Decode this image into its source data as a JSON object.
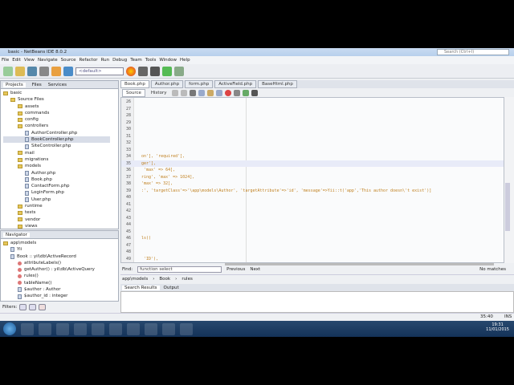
{
  "window": {
    "title": "basic - NetBeans IDE 8.0.2"
  },
  "menu": [
    "File",
    "Edit",
    "View",
    "Navigate",
    "Source",
    "Refactor",
    "Run",
    "Debug",
    "Team",
    "Tools",
    "Window",
    "Help"
  ],
  "search": {
    "placeholder": "Search (Ctrl+I)"
  },
  "toolbar": {
    "config": "<default>"
  },
  "projects": {
    "tabs": [
      "Projects",
      "Files",
      "Services"
    ],
    "tree": [
      {
        "label": "basic",
        "depth": 0,
        "type": "project"
      },
      {
        "label": "Source Files",
        "depth": 1,
        "type": "folder"
      },
      {
        "label": "assets",
        "depth": 2,
        "type": "folder"
      },
      {
        "label": "commands",
        "depth": 2,
        "type": "folder"
      },
      {
        "label": "config",
        "depth": 2,
        "type": "folder"
      },
      {
        "label": "controllers",
        "depth": 2,
        "type": "folder"
      },
      {
        "label": "AuthorController.php",
        "depth": 3,
        "type": "file"
      },
      {
        "label": "BookController.php",
        "depth": 3,
        "type": "file",
        "selected": true
      },
      {
        "label": "SiteController.php",
        "depth": 3,
        "type": "file"
      },
      {
        "label": "mail",
        "depth": 2,
        "type": "folder"
      },
      {
        "label": "migrations",
        "depth": 2,
        "type": "folder"
      },
      {
        "label": "models",
        "depth": 2,
        "type": "folder"
      },
      {
        "label": "Author.php",
        "depth": 3,
        "type": "file"
      },
      {
        "label": "Book.php",
        "depth": 3,
        "type": "file"
      },
      {
        "label": "ContactForm.php",
        "depth": 3,
        "type": "file"
      },
      {
        "label": "LoginForm.php",
        "depth": 3,
        "type": "file"
      },
      {
        "label": "User.php",
        "depth": 3,
        "type": "file"
      },
      {
        "label": "runtime",
        "depth": 2,
        "type": "folder"
      },
      {
        "label": "tests",
        "depth": 2,
        "type": "folder"
      },
      {
        "label": "vendor",
        "depth": 2,
        "type": "folder"
      },
      {
        "label": "views",
        "depth": 2,
        "type": "folder"
      }
    ]
  },
  "navigator": {
    "title": "Navigator",
    "items": [
      {
        "label": "app\\models",
        "depth": 0,
        "type": "folder"
      },
      {
        "label": "Yii",
        "depth": 1,
        "type": "file"
      },
      {
        "label": "Book :: yii\\db\\ActiveRecord",
        "depth": 1,
        "type": "file"
      },
      {
        "label": "attributeLabels()",
        "depth": 2,
        "type": "method"
      },
      {
        "label": "getAuthor() : yii\\db\\ActiveQuery",
        "depth": 2,
        "type": "method"
      },
      {
        "label": "rules()",
        "depth": 2,
        "type": "method"
      },
      {
        "label": "tableName()",
        "depth": 2,
        "type": "method"
      },
      {
        "label": "$author : Author",
        "depth": 2,
        "type": "file"
      },
      {
        "label": "$author_id : integer",
        "depth": 2,
        "type": "file"
      }
    ],
    "filters_label": "Filters:"
  },
  "editor": {
    "tabs": [
      "Book.php",
      "Author.php",
      "form.php",
      "ActiveField.php",
      "BaseHtml.php"
    ],
    "active_tab": 0,
    "subtabs": [
      "Source",
      "History"
    ],
    "lines": [
      {
        "n": "26",
        "code": ""
      },
      {
        "n": "27",
        "code": ""
      },
      {
        "n": "28",
        "code": ""
      },
      {
        "n": "29",
        "code": ""
      },
      {
        "n": "30",
        "code": ""
      },
      {
        "n": "31",
        "code": ""
      },
      {
        "n": "32",
        "code": ""
      },
      {
        "n": "33",
        "code": ""
      },
      {
        "n": "34",
        "code": "on'], 'required'],"
      },
      {
        "n": "35",
        "code": "ger'],"
      },
      {
        "n": "36",
        "code": " 'max' => 64],"
      },
      {
        "n": "37",
        "code": "ring', 'max' => 1024],"
      },
      {
        "n": "38",
        "code": "'max' => 32],"
      },
      {
        "n": "39",
        "code": ":', 'targetClass'=>'\\app\\models\\Author', 'targetAttribute'=>'id', 'message'=>Yii::t('app','This author doesn\\'t exist')]"
      },
      {
        "n": "40",
        "code": ""
      },
      {
        "n": "41",
        "code": ""
      },
      {
        "n": "42",
        "code": ""
      },
      {
        "n": "43",
        "code": ""
      },
      {
        "n": "44",
        "code": ""
      },
      {
        "n": "45",
        "code": ""
      },
      {
        "n": "46",
        "code": "ls()"
      },
      {
        "n": "47",
        "code": ""
      },
      {
        "n": "48",
        "code": ""
      },
      {
        "n": "49",
        "code": " 'ID'),"
      }
    ]
  },
  "find": {
    "label": "Find:",
    "value": "function select",
    "previous": "Previous",
    "next": "Next",
    "status": "No matches"
  },
  "breadcrumb": [
    "app\\models",
    "Book",
    "rules"
  ],
  "output": {
    "tabs": [
      "Search Results",
      "Output"
    ]
  },
  "status": {
    "position": "35:40",
    "mode": "INS"
  },
  "clock": {
    "time": "19:31",
    "date": "11/01/2015"
  }
}
